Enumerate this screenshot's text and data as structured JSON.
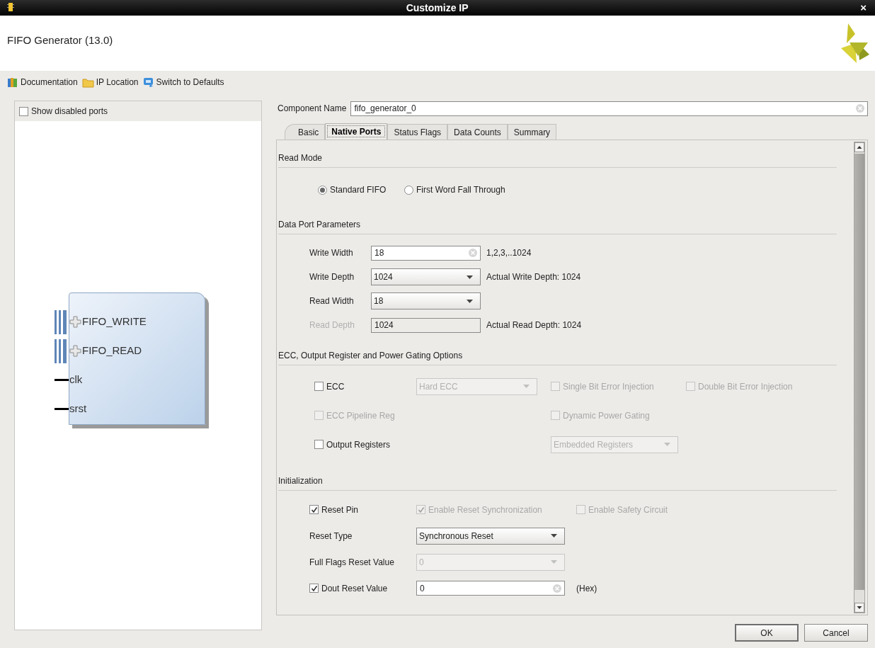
{
  "window": {
    "title": "Customize IP",
    "close": "×"
  },
  "header": {
    "title": "FIFO Generator (13.0)"
  },
  "toolbar": [
    {
      "label": "Documentation",
      "kind": "books"
    },
    {
      "label": "IP Location",
      "kind": "folder"
    },
    {
      "label": "Switch to Defaults",
      "kind": "refresh"
    }
  ],
  "ports_panel": {
    "show_disabled": {
      "label": "Show disabled ports",
      "checked": false
    },
    "ports": [
      {
        "name": "FIFO_WRITE",
        "kind": "bus"
      },
      {
        "name": "FIFO_READ",
        "kind": "bus"
      },
      {
        "name": "clk",
        "kind": "wire"
      },
      {
        "name": "srst",
        "kind": "wire"
      }
    ]
  },
  "component_name": {
    "label": "Component Name",
    "value": "fifo_generator_0"
  },
  "tabs": [
    {
      "label": "Basic",
      "selected": false
    },
    {
      "label": "Native Ports",
      "selected": true
    },
    {
      "label": "Status Flags",
      "selected": false
    },
    {
      "label": "Data Counts",
      "selected": false
    },
    {
      "label": "Summary",
      "selected": false
    }
  ],
  "sections": [
    {
      "title": "Read Mode",
      "rows": [
        {
          "items": [
            {
              "kind": "radio",
              "label": "Standard FIFO",
              "selected": true
            },
            {
              "kind": "radio",
              "label": "First Word Fall Through",
              "selected": false
            }
          ]
        }
      ]
    },
    {
      "title": "Data Port Parameters",
      "rows": [
        {
          "items": [
            {
              "kind": "label",
              "text": "Write Width",
              "disabled": false
            },
            {
              "kind": "field",
              "value": "18",
              "disabled": false
            },
            {
              "kind": "note",
              "text": "1,2,3,..1024"
            }
          ]
        },
        {
          "items": [
            {
              "kind": "label",
              "text": "Write Depth",
              "disabled": false
            },
            {
              "kind": "select",
              "value": "1024",
              "disabled": false
            },
            {
              "kind": "note",
              "text": "Actual Write Depth:  1024"
            }
          ]
        },
        {
          "items": [
            {
              "kind": "label",
              "text": "Read Width",
              "disabled": false
            },
            {
              "kind": "select",
              "value": "18",
              "disabled": false
            }
          ]
        },
        {
          "items": [
            {
              "kind": "label",
              "text": "Read Depth",
              "disabled": true
            },
            {
              "kind": "readonly",
              "value": "1024"
            },
            {
              "kind": "note",
              "text": "Actual Read Depth:  1024"
            }
          ]
        }
      ]
    },
    {
      "title": "ECC, Output Register and Power Gating Options",
      "rows": [
        {
          "items": [
            {
              "kind": "checkbox",
              "label": "ECC",
              "checked": false,
              "disabled": false
            },
            {
              "kind": "select",
              "value": "Hard ECC",
              "disabled": true
            },
            {
              "kind": "checkbox",
              "label": "Single Bit Error Injection",
              "checked": false,
              "disabled": true
            },
            {
              "kind": "checkbox",
              "label": "Double Bit Error Injection",
              "checked": false,
              "disabled": true
            }
          ]
        },
        {
          "items": [
            {
              "kind": "checkbox",
              "label": "ECC Pipeline Reg",
              "checked": false,
              "disabled": true
            },
            {
              "kind": "checkbox",
              "label": "Dynamic Power Gating",
              "checked": false,
              "disabled": true
            }
          ]
        },
        {
          "items": [
            {
              "kind": "checkbox",
              "label": "Output Registers",
              "checked": false,
              "disabled": false
            },
            {
              "kind": "select",
              "value": "Embedded Registers",
              "disabled": true
            }
          ]
        }
      ]
    },
    {
      "title": "Initialization",
      "rows": [
        {
          "items": [
            {
              "kind": "checkbox",
              "label": "Reset Pin",
              "checked": true,
              "disabled": false
            },
            {
              "kind": "checkbox",
              "label": "Enable Reset Synchronization",
              "checked": true,
              "disabled": true
            },
            {
              "kind": "checkbox",
              "label": "Enable Safety Circuit",
              "checked": false,
              "disabled": true
            }
          ]
        },
        {
          "items": [
            {
              "kind": "label",
              "text": "Reset Type",
              "disabled": false
            },
            {
              "kind": "select",
              "value": "Synchronous Reset",
              "disabled": false
            }
          ]
        },
        {
          "items": [
            {
              "kind": "label",
              "text": "Full Flags Reset Value",
              "disabled": false
            },
            {
              "kind": "select",
              "value": "0",
              "disabled": true
            }
          ]
        },
        {
          "items": [
            {
              "kind": "checkbox",
              "label": "Dout Reset Value",
              "checked": true,
              "disabled": false
            },
            {
              "kind": "field",
              "value": "0",
              "disabled": false
            },
            {
              "kind": "note",
              "text": "(Hex)"
            }
          ]
        }
      ]
    }
  ],
  "buttons": [
    {
      "label": "OK",
      "default": true
    },
    {
      "label": "Cancel",
      "default": false
    }
  ]
}
